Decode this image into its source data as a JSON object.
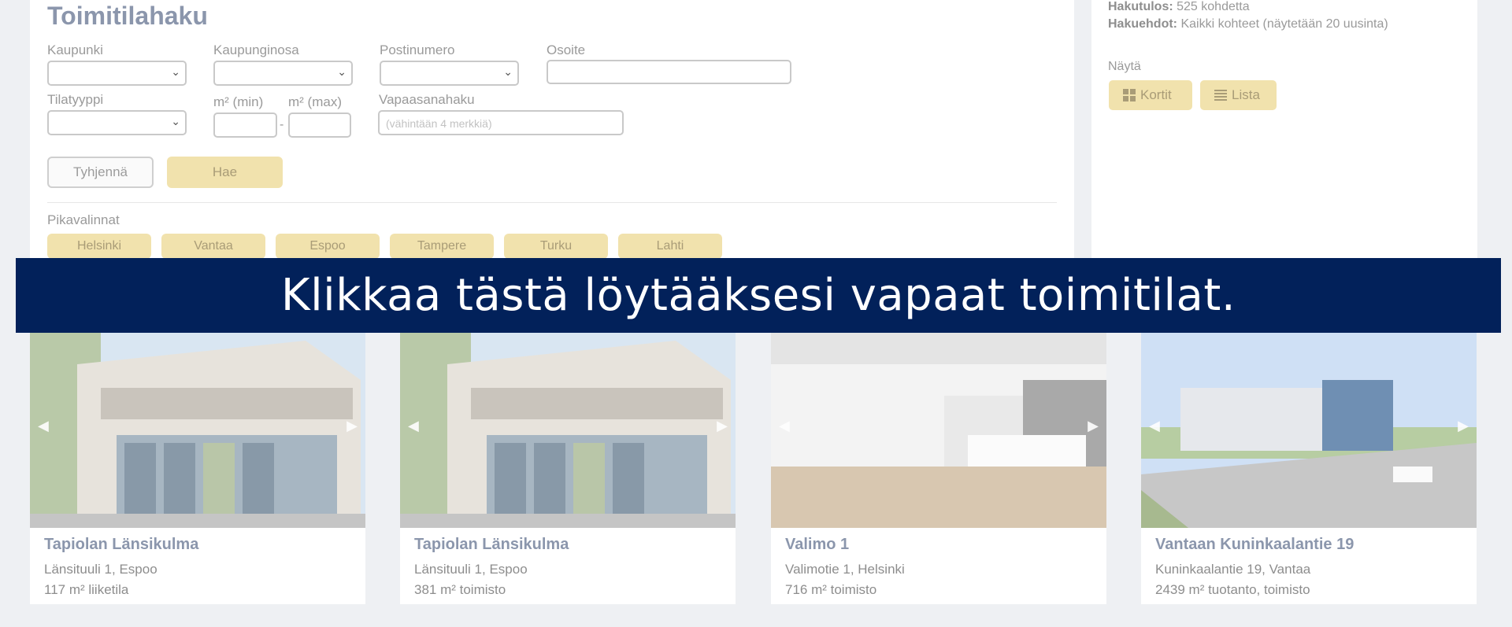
{
  "search": {
    "title": "Toimitilahaku",
    "city_label": "Kaupunki",
    "district_label": "Kaupunginosa",
    "zip_label": "Postinumero",
    "address_label": "Osoite",
    "type_label": "Tilatyyppi",
    "m2_min_label": "m² (min)",
    "m2_max_label": "m² (max)",
    "m2_separator": "-",
    "freetext_label": "Vapaasanahaku",
    "freetext_placeholder": "(vähintään 4 merkkiä)",
    "clear_button": "Tyhjennä",
    "search_button": "Hae",
    "quick_label": "Pikavalinnat",
    "quick": [
      "Helsinki",
      "Vantaa",
      "Espoo",
      "Tampere",
      "Turku",
      "Lahti"
    ]
  },
  "results": {
    "count_label": "Hakutulos:",
    "count_value": "525 kohdetta",
    "criteria_label": "Hakuehdot:",
    "criteria_value": "Kaikki kohteet (näytetään 20 uusinta)",
    "view_label": "Näytä",
    "cards_button": "Kortit",
    "list_button": "Lista"
  },
  "banner": {
    "text": "Klikkaa tästä löytääksesi vapaat toimitilat.",
    "color": "#02215a"
  },
  "cards": [
    {
      "name": "Tapiolan Länsikulma",
      "address": "Länsituuli 1, Espoo",
      "size": "117 m² liiketila"
    },
    {
      "name": "Tapiolan Länsikulma",
      "address": "Länsituuli 1, Espoo",
      "size": "381 m² toimisto"
    },
    {
      "name": "Valimo 1",
      "address": "Valimotie 1, Helsinki",
      "size": "716 m² toimisto"
    },
    {
      "name": "Vantaan Kuninkaalantie 19",
      "address": "Kuninkaalantie 19, Vantaa",
      "size": "2439 m² tuotanto, toimisto"
    }
  ],
  "colors": {
    "accent": "#f1e2ad",
    "title": "#8b96ac"
  }
}
